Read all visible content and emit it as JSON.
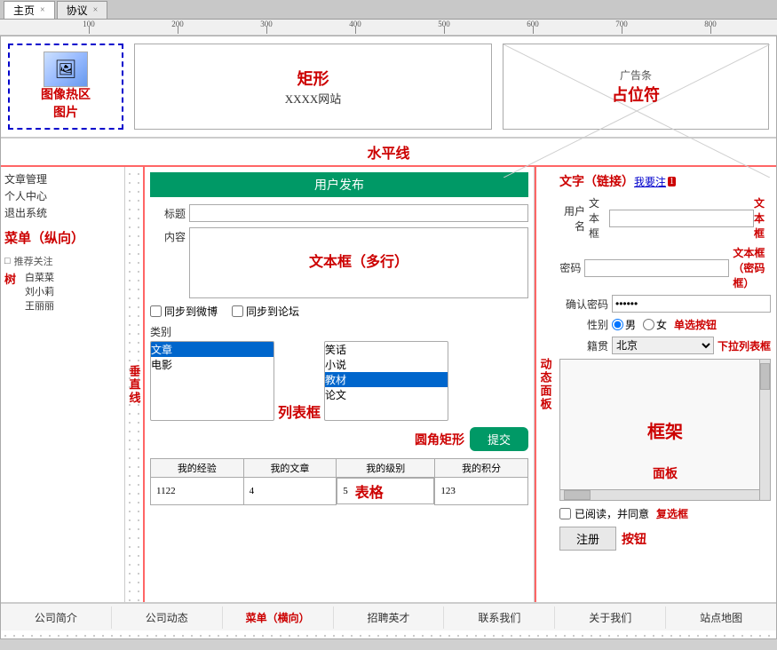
{
  "tabs": [
    {
      "label": "主页",
      "active": true
    },
    {
      "label": "协议",
      "active": false
    }
  ],
  "ruler": {
    "marks": [
      100,
      200,
      300,
      400,
      500,
      600,
      700,
      800
    ]
  },
  "top": {
    "image_hotspot_label": "图像热区\n图片",
    "rectangle_label": "矩形",
    "site_name": "XXXX网站",
    "ad_label": "广告条",
    "placeholder_label": "占位符"
  },
  "horizontal_line_label": "水平线",
  "left_panel": {
    "menu_items": [
      "文章管理",
      "个人中心",
      "退出系统"
    ],
    "menu_label": "菜单（纵向）",
    "tree_title": "推荐关注",
    "tree_label": "树",
    "tree_items": [
      "白菜菜",
      "刘小莉",
      "王丽丽"
    ]
  },
  "center_panel": {
    "user_post_label": "用户发布",
    "title_label": "标题",
    "content_label": "内容",
    "textarea_label": "文本框（多行）",
    "sync_weibo": "同步到微博",
    "sync_forum": "同步到论坛",
    "category_label": "类别",
    "listbox_label": "列表框",
    "listbox_left": [
      "文章",
      "电影"
    ],
    "listbox_right": [
      "笑话",
      "小说",
      "教材",
      "论文"
    ],
    "submit_label": "提交",
    "rounded_rect_label": "圆角矩形",
    "table": {
      "headers": [
        "我的经验",
        "我的文章",
        "我的级别",
        "我的积分"
      ],
      "rows": [
        [
          "1122",
          "4",
          "5",
          "123"
        ]
      ]
    },
    "table_label": "表格"
  },
  "vertical_line_label": "垂直线",
  "dynamic_label": "动态面板",
  "right_panel": {
    "text_link_label": "文字（链接）",
    "link_text": "我要注",
    "badge": "1",
    "username_label": "用户名",
    "username_sublabel": "文本框",
    "textbox_label": "文本框",
    "password_label": "密码",
    "password_sublabel": "文本框（密码框）",
    "password_dots": "••文本框（密码框）",
    "confirm_label": "确认密码",
    "confirm_dots": "••••••",
    "gender_label": "性别",
    "male_label": "男",
    "female_label": "女",
    "single_select_label": "单选按钮",
    "region_label": "籍贯",
    "region_value": "北京",
    "dropdown_label": "下拉列表框",
    "frame_label": "框架",
    "panel_label": "面板",
    "agree_text": "已阅读，并同意",
    "checkbox_label": "复选框",
    "register_label": "注册",
    "btn_label": "按钮"
  },
  "bottom_nav": {
    "items": [
      "公司简介",
      "公司动态",
      "菜单（横向）",
      "招聘英才",
      "联系我们",
      "关于我们",
      "站点地图"
    ],
    "label": "菜单（横向）",
    "label_index": 2
  }
}
